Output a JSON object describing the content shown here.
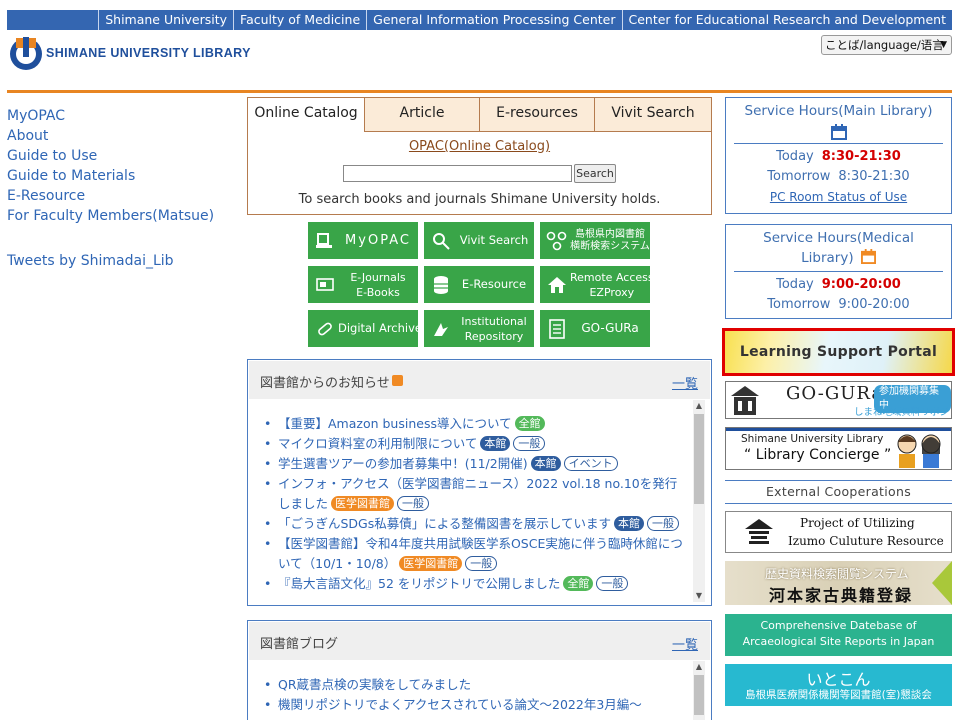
{
  "topbar": {
    "links": [
      "Shimane University",
      "Faculty of Medicine",
      "General Information Processing Center",
      "Center for Educational Research and Development"
    ]
  },
  "logo": {
    "text": "SHIMANE UNIVERSITY LIBRARY"
  },
  "language": {
    "label": "ことば/language/语言"
  },
  "leftnav": {
    "items": [
      "MyOPAC",
      "About",
      "Guide to Use",
      "Guide to Materials",
      "E-Resource",
      "For Faculty Members(Matsue)"
    ],
    "tweets": "Tweets by Shimadai_Lib"
  },
  "catalog": {
    "tabs": [
      "Online Catalog",
      "Article",
      "E-resources",
      "Vivit Search"
    ],
    "opac_link": "OPAC(Online Catalog)",
    "search_button": "Search",
    "description": "To search books and journals Shimane University holds."
  },
  "quick_buttons": [
    {
      "label1": "MyOPAC",
      "label2": "",
      "icon": "book-pc-icon"
    },
    {
      "label1": "Vivit Search",
      "label2": "",
      "icon": "magnifier-icon"
    },
    {
      "label1": "島根県内図書館",
      "label2": "横断検索システム",
      "icon": "network-icon"
    },
    {
      "label1": "E-Journals",
      "label2": "E-Books",
      "icon": "ebook-icon"
    },
    {
      "label1": "E-Resource",
      "label2": "",
      "icon": "database-icon"
    },
    {
      "label1": "Remote Access",
      "label2": "EZProxy",
      "icon": "house-icon"
    },
    {
      "label1": "Digital Archive",
      "label2": "",
      "icon": "scroll-icon"
    },
    {
      "label1": "Institutional",
      "label2": "Repository",
      "icon": "bird-icon"
    },
    {
      "label1": "GO-GURa",
      "label2": "",
      "icon": "gogura-icon"
    }
  ],
  "news": {
    "title": "図書館からのお知らせ",
    "more": "一覧",
    "items": [
      {
        "text": "【重要】Amazon business導入について",
        "badges": [
          {
            "label": "全館",
            "style": "green"
          }
        ]
      },
      {
        "text": "マイクロ資料室の利用制限について",
        "badges": [
          {
            "label": "本館",
            "style": "navy"
          },
          {
            "label": "一般",
            "style": "outline"
          }
        ]
      },
      {
        "text": "学生選書ツアーの参加者募集中！(11/2開催)",
        "badges": [
          {
            "label": "本館",
            "style": "navy"
          },
          {
            "label": "イベント",
            "style": "outline"
          }
        ]
      },
      {
        "text": "インフォ・アクセス（医学図書館ニュース）2022 vol.18 no.10を発行しました",
        "badges": [
          {
            "label": "医学図書館",
            "style": "orange"
          },
          {
            "label": "一般",
            "style": "outline"
          }
        ]
      },
      {
        "text": "「ごうぎんSDGs私募債」による整備図書を展示しています",
        "badges": [
          {
            "label": "本館",
            "style": "navy"
          },
          {
            "label": "一般",
            "style": "outline"
          }
        ]
      },
      {
        "text": "【医学図書館】令和4年度共用試験医学系OSCE実施に伴う臨時休館について（10/1・10/8）",
        "badges": [
          {
            "label": "医学図書館",
            "style": "orange"
          },
          {
            "label": "一般",
            "style": "outline"
          }
        ]
      },
      {
        "text": "『島大言語文化』52 をリポジトリで公開しました",
        "badges": [
          {
            "label": "全館",
            "style": "green"
          },
          {
            "label": "一般",
            "style": "outline"
          }
        ]
      }
    ]
  },
  "blog": {
    "title": "図書館ブログ",
    "more": "一覧",
    "items": [
      {
        "text": "QR蔵書点検の実験をしてみました",
        "badges": []
      },
      {
        "text": "機関リポジトリでよくアクセスされている論文～2022年3月編～",
        "badges": []
      }
    ]
  },
  "main_hours": {
    "title": "Service Hours(Main Library)",
    "today_label": "Today",
    "today_value": "8:30-21:30",
    "tomorrow_label": "Tomorrow",
    "tomorrow_value": "8:30-21:30",
    "pc_link": "PC Room Status of Use"
  },
  "medical_hours": {
    "title1": "Service Hours(Medical",
    "title2": "Library)",
    "today_label": "Today",
    "today_value": "9:00-20:00",
    "tomorrow_label": "Tomorrow",
    "tomorrow_value": "9:00-20:00"
  },
  "banners": {
    "learning_support": "Learning Support Portal",
    "gogura_main": "GO-GURa",
    "gogura_tag": "参加機関募集中",
    "gogura_sub": "しまね地域資料リポジトリ",
    "concierge_top": "Shimane University Library",
    "concierge_main": "“ Library Concierge ”",
    "external": "External Cooperations",
    "izumo1": "Project of Utilizing",
    "izumo2": "Izumo Culuture Resource",
    "kawamoto1": "歴史資料検索閲覧システム",
    "kawamoto2": "河本家古典籍登録",
    "archaeo1": "Comprehensive Datebase of",
    "archaeo2": "Arcaeological Site Reports in Japan",
    "itoken1": "いとこん",
    "itoken2": "島根県医療関係機関等図書館(室)懇談会"
  }
}
